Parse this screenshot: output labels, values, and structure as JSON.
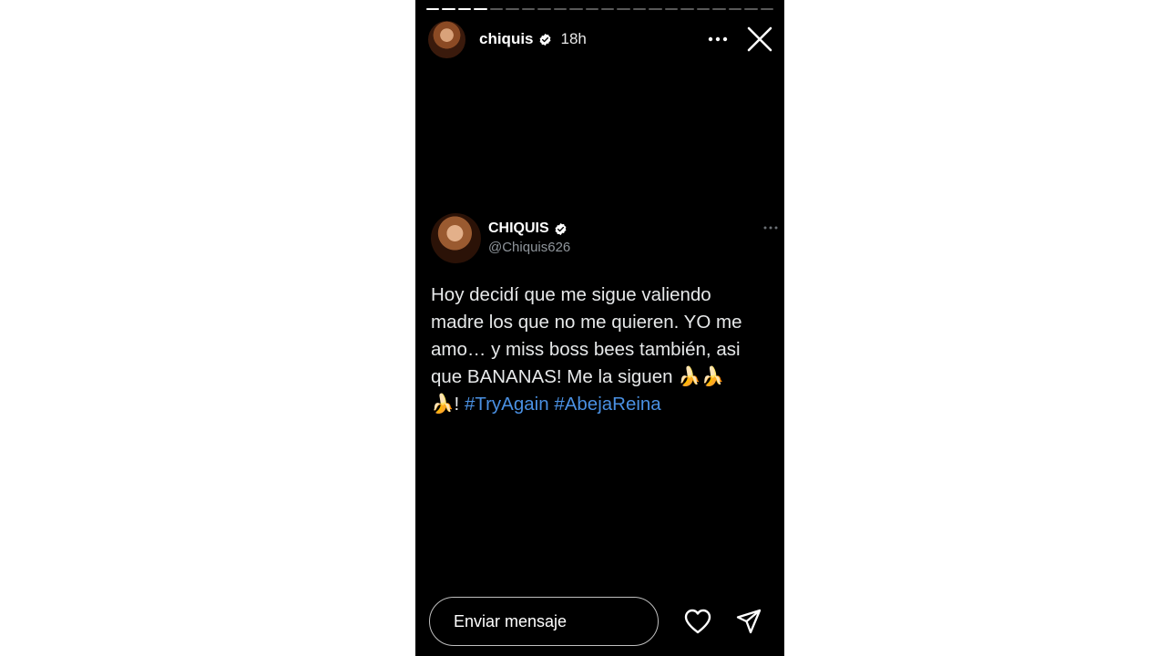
{
  "story": {
    "progress": {
      "total_segments": 22,
      "completed_segments": 4
    },
    "header": {
      "username": "chiquis",
      "time_ago": "18h",
      "verified_icon": "verified-badge-icon",
      "more_icon": "more-dots-icon",
      "close_icon": "close-icon"
    },
    "tweet": {
      "display_name": "CHIQUIS",
      "handle": "@Chiquis626",
      "text_lines": [
        "Hoy decidí que me sigue valiendo",
        "madre los que no me quieren. YO me",
        "amo… y miss boss bees también, asi",
        "que BANANAS! Me la siguen "
      ],
      "emoji_banana": "🍌",
      "text_exclaim": "!",
      "hashtags": [
        "#TryAgain",
        "#AbejaReina"
      ],
      "more_icon": "more-dots-icon"
    },
    "footer": {
      "message_placeholder": "Enviar mensaje",
      "like_icon": "heart-icon",
      "send_icon": "send-icon"
    },
    "colors": {
      "background": "#000000",
      "hashtag": "#4a90e2",
      "handle": "#8f959b",
      "text": "#e7e9ea"
    }
  }
}
